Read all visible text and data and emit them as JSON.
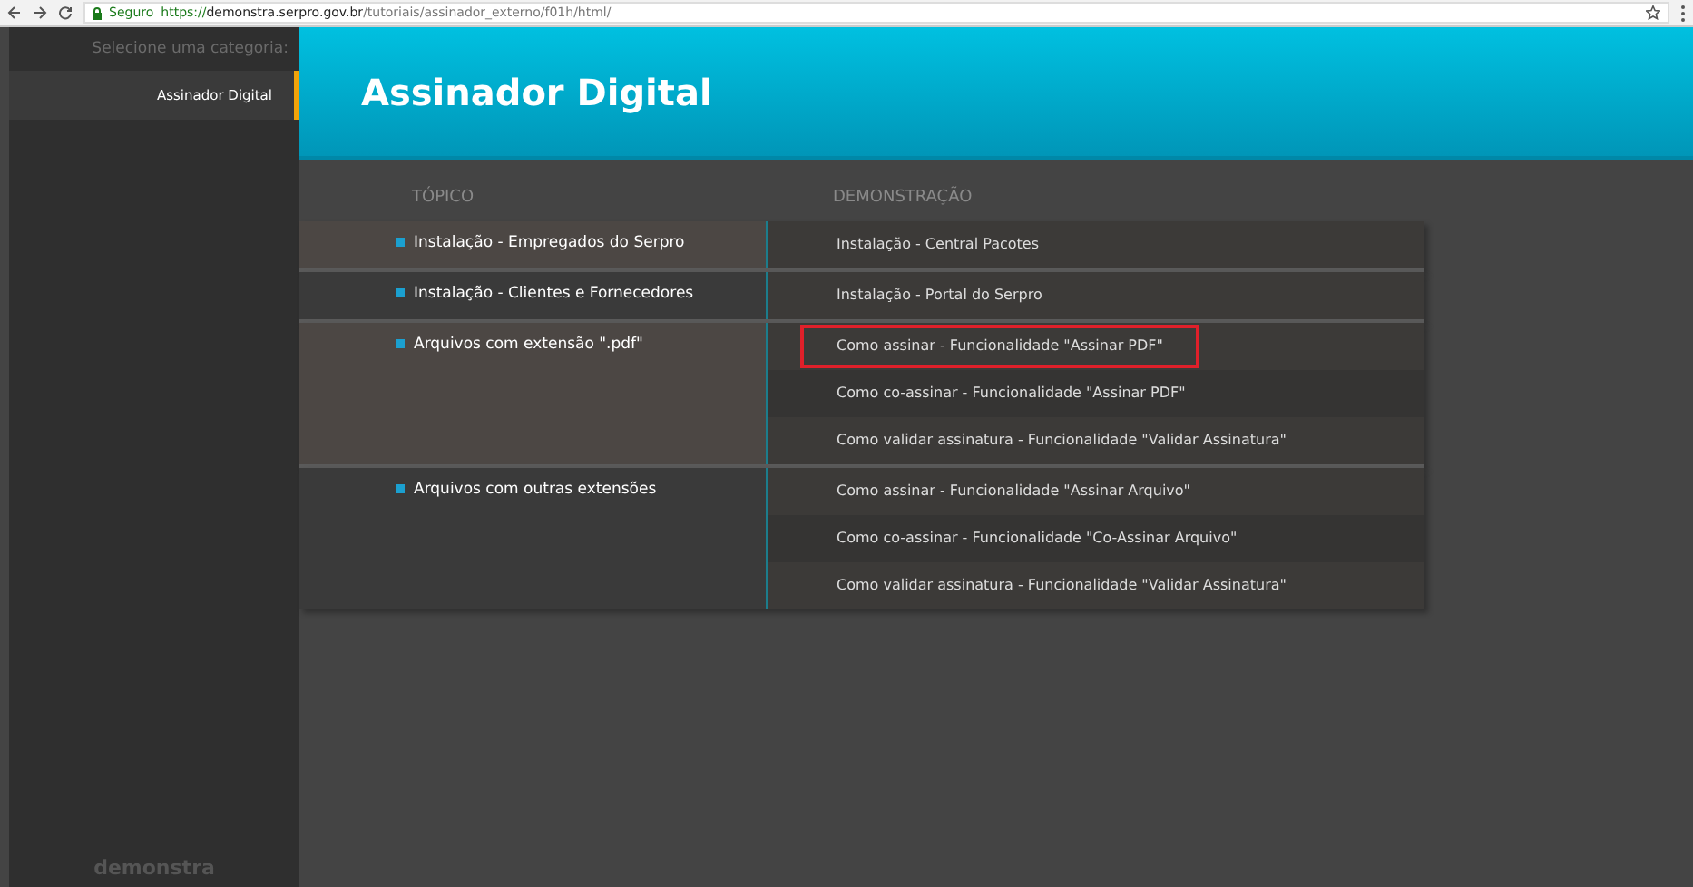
{
  "browser": {
    "security": "Seguro",
    "url_scheme": "https://",
    "url_host": "demonstra.serpro.gov.br",
    "url_path": "/tutoriais/assinador_externo/f01h/html/"
  },
  "sidebar": {
    "heading": "Selecione uma categoria:",
    "items": [
      {
        "label": "Assinador Digital",
        "selected": true
      }
    ],
    "footer_logo": "demonstra"
  },
  "header": {
    "title": "Assinador Digital"
  },
  "table": {
    "columns": [
      "TÓPICO",
      "DEMONSTRAÇÃO"
    ],
    "groups": [
      {
        "topic": "Instalação - Empregados do Serpro",
        "demos": [
          {
            "label": "Instalação - Central Pacotes",
            "highlighted": false
          }
        ]
      },
      {
        "topic": "Instalação - Clientes e Fornecedores",
        "demos": [
          {
            "label": "Instalação - Portal do Serpro",
            "highlighted": false
          }
        ]
      },
      {
        "topic": "Arquivos com extensão \".pdf\"",
        "demos": [
          {
            "label": "Como assinar - Funcionalidade \"Assinar PDF\"",
            "highlighted": true
          },
          {
            "label": "Como co-assinar - Funcionalidade \"Assinar PDF\"",
            "highlighted": false
          },
          {
            "label": "Como validar assinatura - Funcionalidade \"Validar Assinatura\"",
            "highlighted": false
          }
        ]
      },
      {
        "topic": "Arquivos com outras extensões",
        "demos": [
          {
            "label": "Como assinar - Funcionalidade \"Assinar Arquivo\"",
            "highlighted": false
          },
          {
            "label": "Como co-assinar - Funcionalidade \"Co-Assinar Arquivo\"",
            "highlighted": false
          },
          {
            "label": "Como validar assinatura - Funcionalidade \"Validar Assinatura\"",
            "highlighted": false
          }
        ]
      }
    ]
  }
}
